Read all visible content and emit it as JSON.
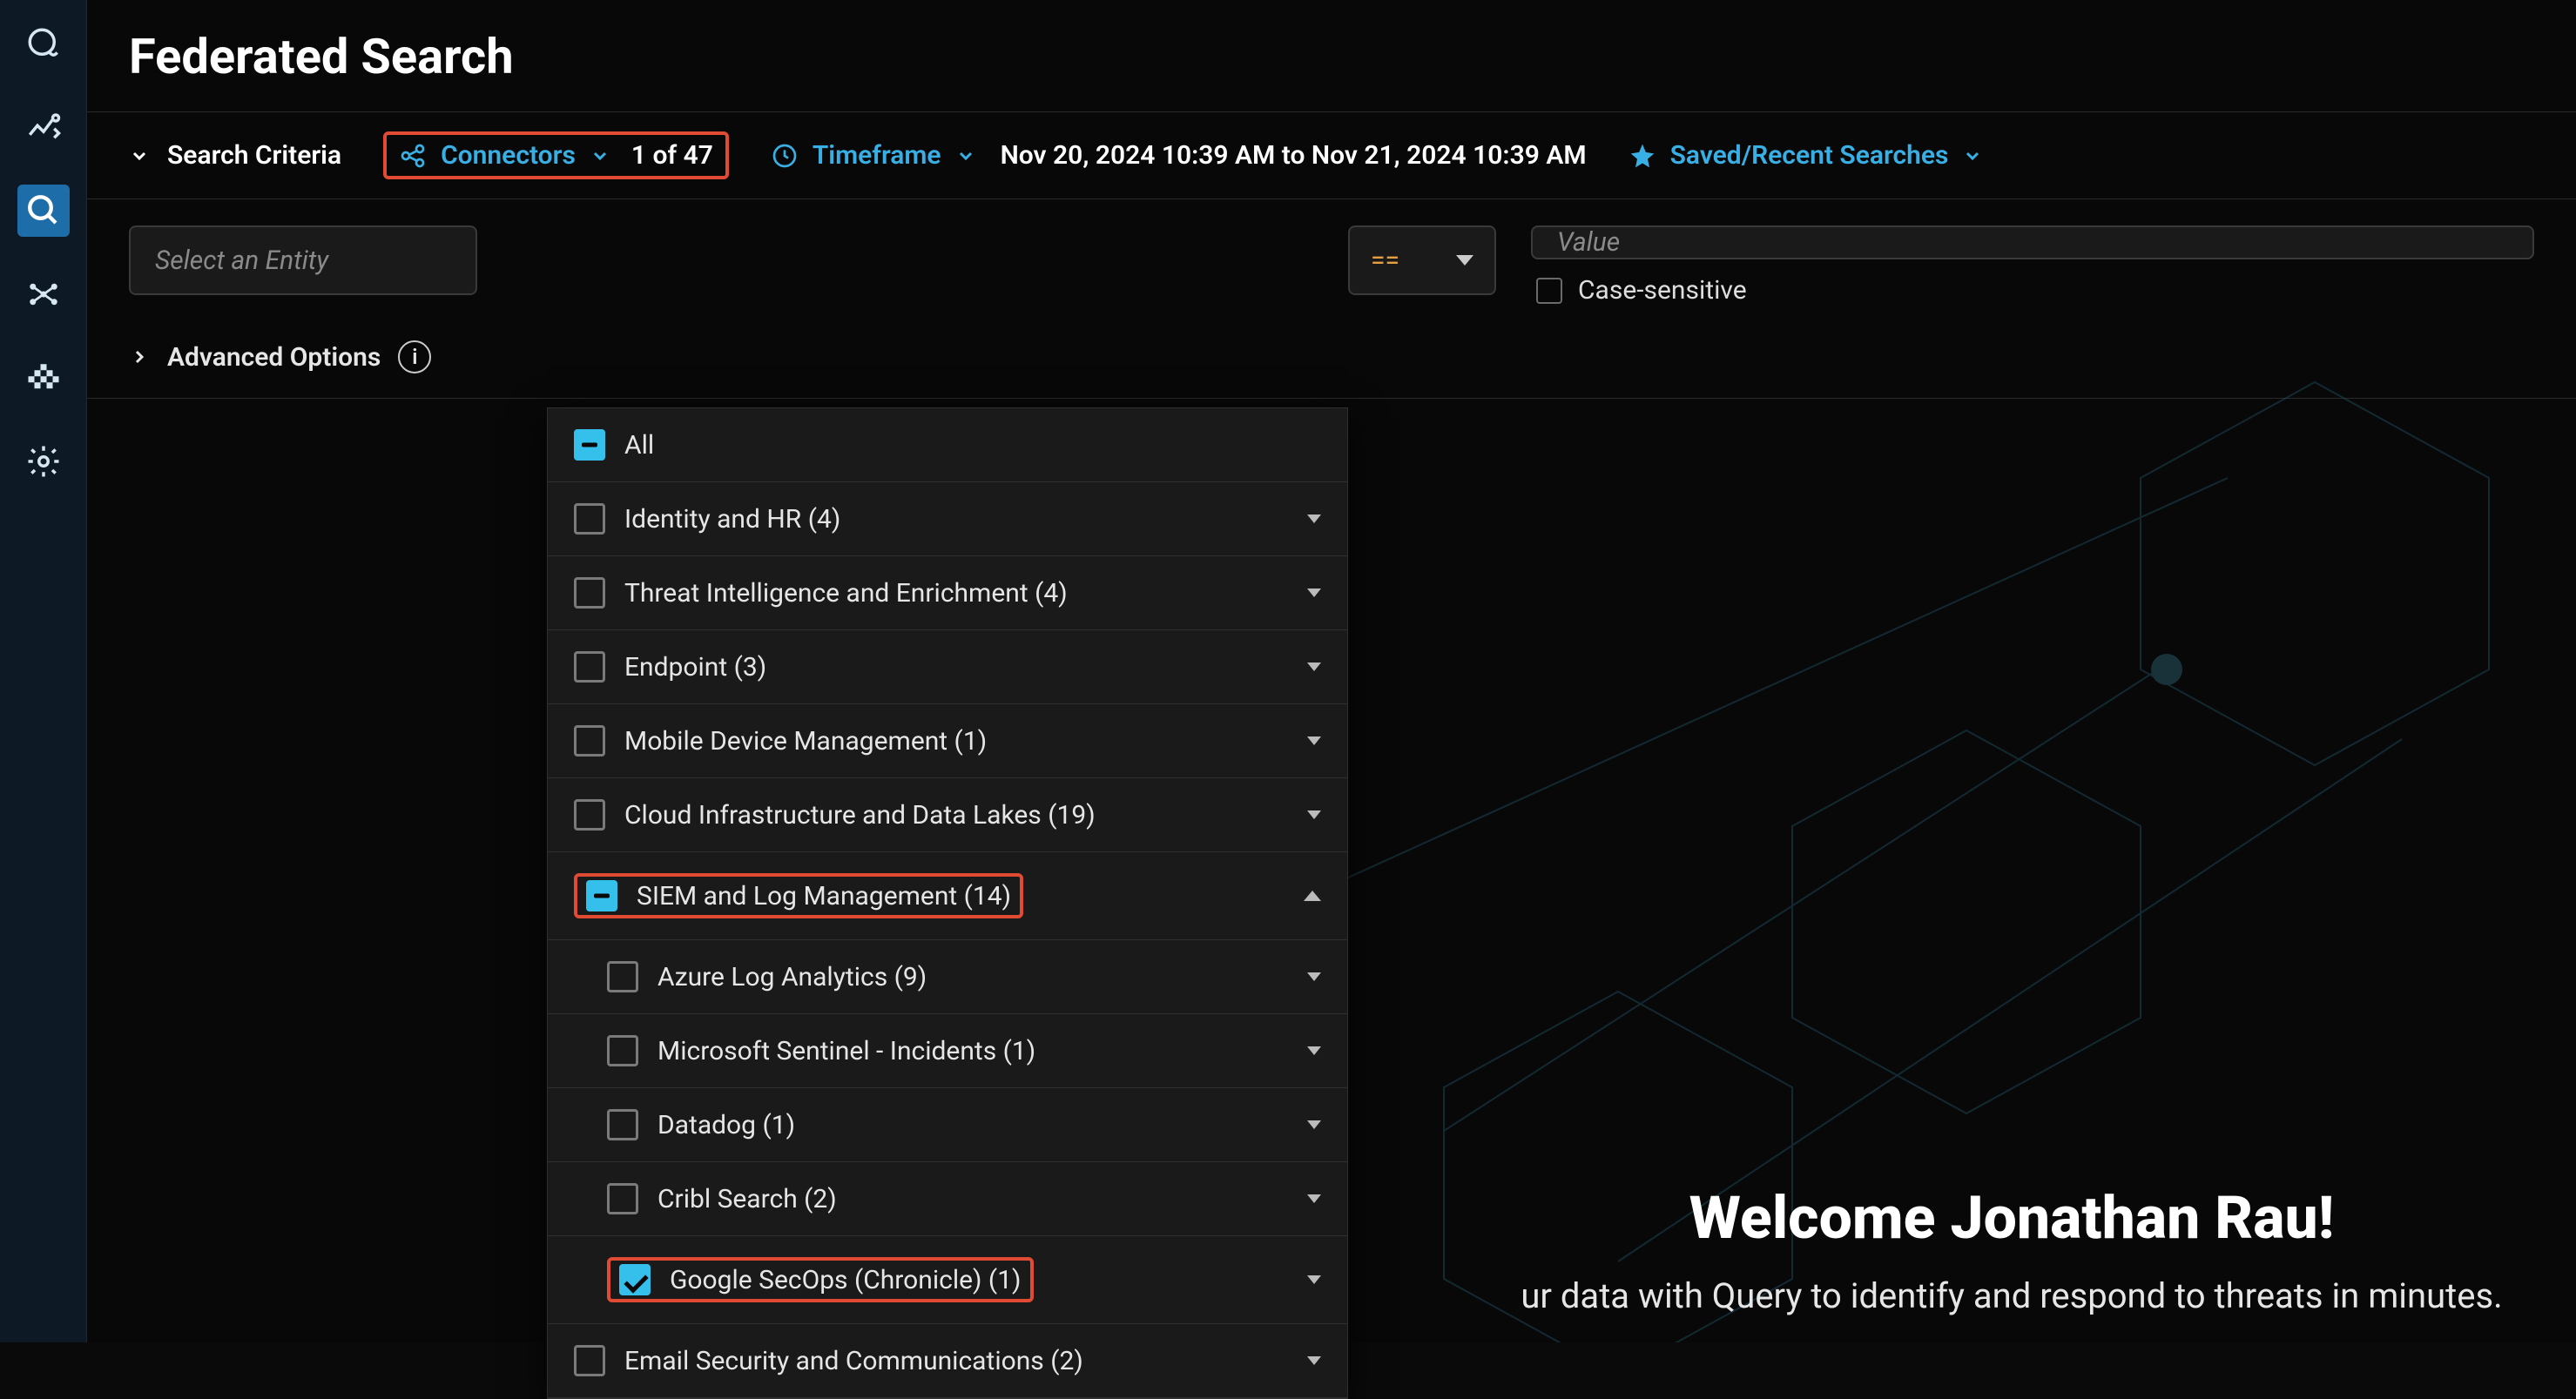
{
  "header": {
    "title": "Federated Search"
  },
  "criteria": {
    "label": "Search Criteria",
    "connectors_label": "Connectors",
    "connectors_count": "1 of 47",
    "timeframe_label": "Timeframe",
    "timeframe_range": "Nov 20, 2024 10:39 AM to Nov 21, 2024 10:39 AM",
    "saved_label": "Saved/Recent Searches"
  },
  "entity": {
    "placeholder": "Select an Entity",
    "operator": "==",
    "value_placeholder": "Value",
    "case_sensitive_label": "Case-sensitive"
  },
  "advanced": {
    "label": "Advanced Options"
  },
  "dropdown": {
    "all": "All",
    "items": [
      {
        "label": "Identity and HR (4)",
        "child": false,
        "state": "unchecked",
        "caret": "down"
      },
      {
        "label": "Threat Intelligence and Enrichment (4)",
        "child": false,
        "state": "unchecked",
        "caret": "down"
      },
      {
        "label": "Endpoint (3)",
        "child": false,
        "state": "unchecked",
        "caret": "down"
      },
      {
        "label": "Mobile Device Management (1)",
        "child": false,
        "state": "unchecked",
        "caret": "down"
      },
      {
        "label": "Cloud Infrastructure and Data Lakes (19)",
        "child": false,
        "state": "unchecked",
        "caret": "down"
      },
      {
        "label": "SIEM and Log Management (14)",
        "child": false,
        "state": "minus",
        "caret": "up",
        "highlight": true
      },
      {
        "label": "Azure Log Analytics (9)",
        "child": true,
        "state": "unchecked",
        "caret": "down"
      },
      {
        "label": "Microsoft Sentinel - Incidents (1)",
        "child": true,
        "state": "unchecked",
        "caret": "down"
      },
      {
        "label": "Datadog (1)",
        "child": true,
        "state": "unchecked",
        "caret": "down"
      },
      {
        "label": "Cribl Search (2)",
        "child": true,
        "state": "unchecked",
        "caret": "down"
      },
      {
        "label": "Google SecOps (Chronicle) (1)",
        "child": true,
        "state": "checked",
        "caret": "down",
        "highlight": true
      },
      {
        "label": "Email Security and Communications (2)",
        "child": false,
        "state": "unchecked",
        "caret": "down"
      }
    ]
  },
  "welcome": {
    "heading": "Welcome Jonathan Rau!",
    "sub_prefix": "ur data with Query to identify and respond to threats in minutes."
  }
}
